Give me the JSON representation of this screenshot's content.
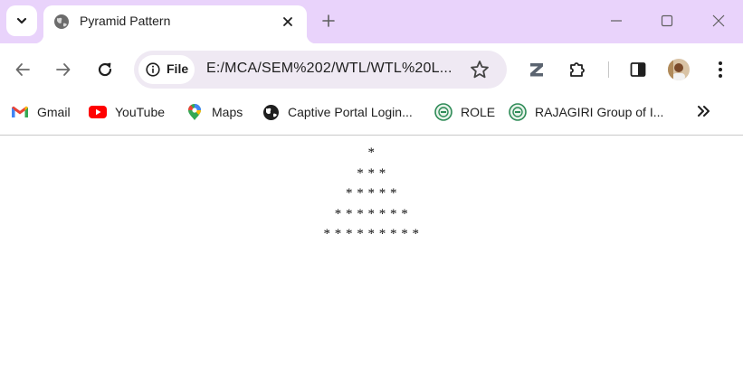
{
  "window": {
    "tab_title": "Pyramid Pattern",
    "colors": {
      "frame": "#e9d3fb",
      "omnibox": "#efe9f3"
    }
  },
  "toolbar": {
    "site_chip_label": "File",
    "url": "E:/MCA/SEM%202/WTL/WTL%20L..."
  },
  "bookmarks": {
    "items": [
      {
        "label": "Gmail",
        "icon": "gmail-icon"
      },
      {
        "label": "YouTube",
        "icon": "youtube-icon"
      },
      {
        "label": "Maps",
        "icon": "maps-icon"
      },
      {
        "label": "Captive Portal Login...",
        "icon": "globe-icon"
      },
      {
        "label": "ROLE",
        "icon": "rajagiri-icon"
      },
      {
        "label": "RAJAGIRI Group of I...",
        "icon": "rajagiri-icon"
      }
    ]
  },
  "page": {
    "pyramid_rows": [
      "*",
      "* * *",
      "* * * * *",
      "* * * * * * *",
      "* * * * * * * * *"
    ]
  }
}
